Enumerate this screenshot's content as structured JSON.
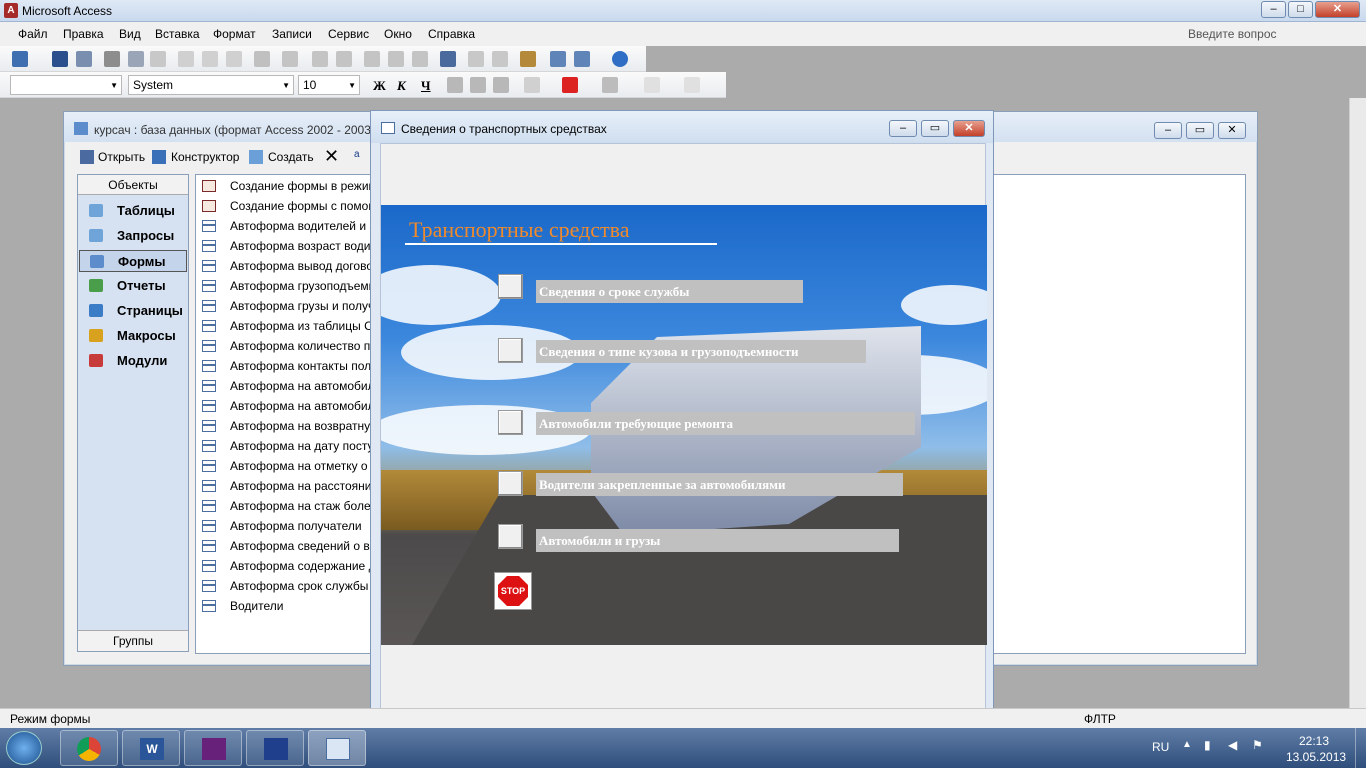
{
  "app": {
    "title": "Microsoft Access",
    "ask_placeholder": "Введите вопрос"
  },
  "menu": [
    "Файл",
    "Правка",
    "Вид",
    "Вставка",
    "Формат",
    "Записи",
    "Сервис",
    "Окно",
    "Справка"
  ],
  "format_toolbar": {
    "object_combo": "",
    "font_combo": "System",
    "size_combo": "10",
    "bold": "Ж",
    "italic": "К",
    "underline": "Ч"
  },
  "db_window": {
    "title": "курсач : база данных (формат Access 2002 - 2003)",
    "toolbar": {
      "open": "Открыть",
      "design": "Конструктор",
      "create": "Создать"
    },
    "objects_header": "Объекты",
    "groups_footer": "Группы",
    "objects": [
      {
        "label": "Таблицы",
        "icon": "table-icon",
        "color": "#6fa4d8"
      },
      {
        "label": "Запросы",
        "icon": "query-icon",
        "color": "#6fa4d8"
      },
      {
        "label": "Формы",
        "icon": "form-icon",
        "color": "#5d8ccc"
      },
      {
        "label": "Отчеты",
        "icon": "report-icon",
        "color": "#4a9e4a"
      },
      {
        "label": "Страницы",
        "icon": "page-icon",
        "color": "#3a7cc6"
      },
      {
        "label": "Макросы",
        "icon": "macro-icon",
        "color": "#d8a21e"
      },
      {
        "label": "Модули",
        "icon": "module-icon",
        "color": "#c83b3b"
      }
    ],
    "selected_object": "Формы",
    "items": [
      "Создание формы в режиме конструктора",
      "Создание формы с помощью мастера",
      "Автоформа водителей и автомобилей",
      "Автоформа возраст водителей",
      "Автоформа вывод договоров",
      "Автоформа грузоподъемность",
      "Автоформа грузы и получатели",
      "Автоформа из таблицы Сведения",
      "Автоформа количество получателей",
      "Автоформа контакты получателей",
      "Автоформа на автомобили",
      "Автоформа на автомобили по дате",
      "Автоформа на возвратную тару",
      "Автоформа на дату поступления",
      "Автоформа на отметку о доставке",
      "Автоформа на расстояние",
      "Автоформа на стаж более",
      "Автоформа получатели",
      "Автоформа сведений о водителях",
      "Автоформа содержание документов",
      "Автоформа срок службы",
      "Водители"
    ]
  },
  "form_window": {
    "title": "Сведения о транспортных средствах",
    "heading": "Транспортные средства",
    "buttons": [
      "Сведения о сроке службы",
      "Сведения о типе кузова и грузоподъемности",
      "Автомобили требующие ремонта",
      "Водители закрепленные за автомобилями",
      "Автомобили и грузы"
    ],
    "stop_label": "STOP"
  },
  "status": {
    "mode": "Режим формы",
    "filter": "ФЛТР"
  },
  "taskbar": {
    "lang": "RU",
    "time": "22:13",
    "date": "13.05.2013"
  }
}
